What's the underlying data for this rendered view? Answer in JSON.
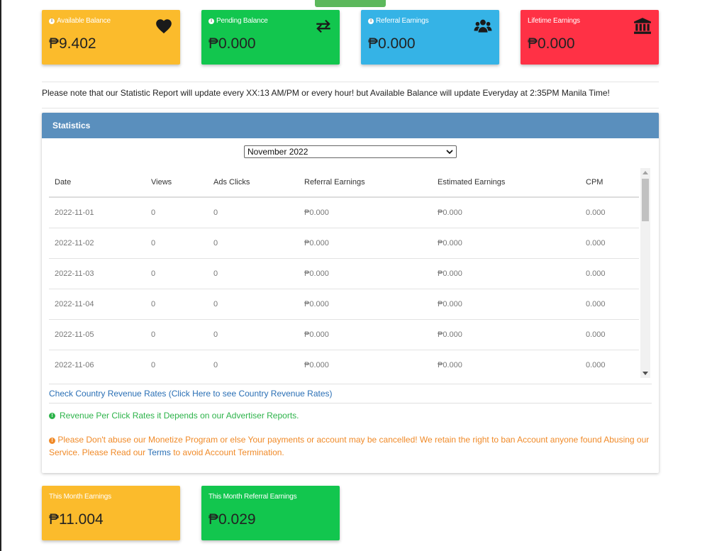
{
  "colors": {
    "available_card": "#fbbb2c",
    "pending_card": "#12c64e",
    "referral_card": "#35b3e6",
    "lifetime_card": "#ff3145",
    "panel_header": "#5a8fbd",
    "link": "#2a6fb5",
    "note_green": "#2db34a",
    "note_orange": "#f08a28"
  },
  "cards": {
    "available": {
      "label": "Available Balance",
      "value": "₱9.402",
      "icon": "heart-icon"
    },
    "pending": {
      "label": "Pending Balance",
      "value": "₱0.000",
      "icon": "exchange-arrows-icon"
    },
    "referral": {
      "label": "Referral Earnings",
      "value": "₱0.000",
      "icon": "users-icon"
    },
    "lifetime": {
      "label": "Lifetime Earnings",
      "value": "₱0.000",
      "icon": "bank-icon"
    }
  },
  "notice": "Please note that our Statistic Report will update every XX:13 AM/PM or every hour! but Available Balance will update Everyday at 2:35PM Manila Time!",
  "statistics": {
    "title": "Statistics",
    "month_selected": "November 2022",
    "columns": [
      "Date",
      "Views",
      "Ads Clicks",
      "Referral Earnings",
      "Estimated Earnings",
      "CPM"
    ],
    "rows": [
      [
        "2022-11-01",
        "0",
        "0",
        "₱0.000",
        "₱0.000",
        "0.000"
      ],
      [
        "2022-11-02",
        "0",
        "0",
        "₱0.000",
        "₱0.000",
        "0.000"
      ],
      [
        "2022-11-03",
        "0",
        "0",
        "₱0.000",
        "₱0.000",
        "0.000"
      ],
      [
        "2022-11-04",
        "0",
        "0",
        "₱0.000",
        "₱0.000",
        "0.000"
      ],
      [
        "2022-11-05",
        "0",
        "0",
        "₱0.000",
        "₱0.000",
        "0.000"
      ],
      [
        "2022-11-06",
        "0",
        "0",
        "₱0.000",
        "₱0.000",
        "0.000"
      ]
    ],
    "country_link": "Check Country Revenue Rates (Click Here to see Country Revenue Rates)",
    "green_note": "Revenue Per Click Rates it Depends on our Advertiser Reports.",
    "orange_note_before": "Please Don't abuse our Monetize Program or else Your payments or account may be cancelled! We retain the right to ban Account anyone found Abusing our Service. Please Read our",
    "orange_note_link": "Terms",
    "orange_note_after": "to avoid Account Termination."
  },
  "bottom_cards": {
    "month": {
      "label": "This Month Earnings",
      "value": "₱11.004"
    },
    "month_referral": {
      "label": "This Month Referral Earnings",
      "value": "₱0.029"
    }
  }
}
